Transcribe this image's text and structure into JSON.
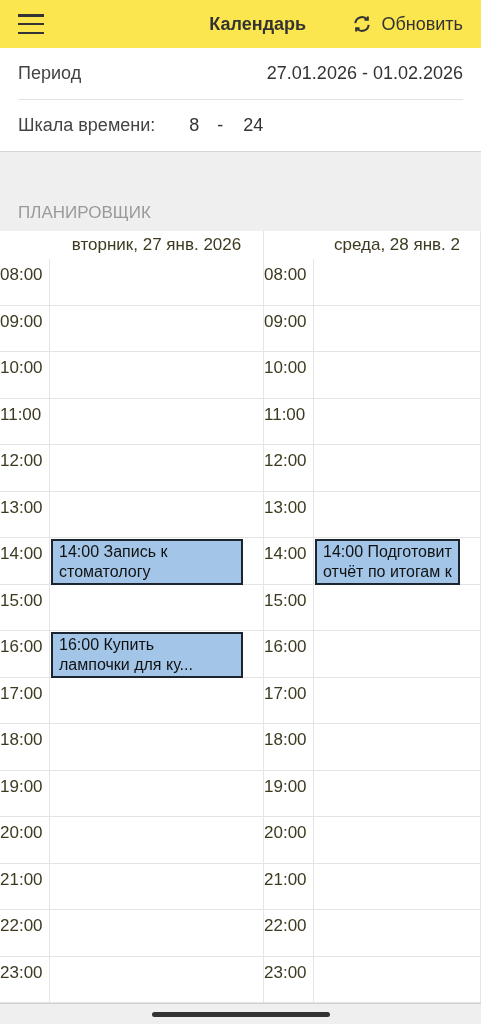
{
  "header": {
    "title": "Календарь",
    "refresh_label": "Обновить"
  },
  "period": {
    "label": "Период",
    "value": "27.01.2026 - 01.02.2026"
  },
  "time_scale": {
    "label": "Шкала времени:",
    "from": "8",
    "separator": "-",
    "to": "24"
  },
  "planner": {
    "title": "ПЛАНИРОВЩИК",
    "days": [
      {
        "label": "вторник, 27 янв. 2026",
        "slots": [
          {
            "time": "08:00"
          },
          {
            "time": "09:00"
          },
          {
            "time": "10:00"
          },
          {
            "time": "11:00"
          },
          {
            "time": "12:00"
          },
          {
            "time": "13:00"
          },
          {
            "time": "14:00",
            "event": {
              "lines": [
                "14:00 Запись к",
                "стоматологу"
              ]
            }
          },
          {
            "time": "15:00"
          },
          {
            "time": "16:00",
            "event": {
              "lines": [
                "16:00 Купить",
                "лампочки для ку..."
              ]
            }
          },
          {
            "time": "17:00"
          },
          {
            "time": "18:00"
          },
          {
            "time": "19:00"
          },
          {
            "time": "20:00"
          },
          {
            "time": "21:00"
          },
          {
            "time": "22:00"
          },
          {
            "time": "23:00"
          }
        ]
      },
      {
        "label": "среда, 28 янв. 2",
        "slots": [
          {
            "time": "08:00"
          },
          {
            "time": "09:00"
          },
          {
            "time": "10:00"
          },
          {
            "time": "11:00"
          },
          {
            "time": "12:00"
          },
          {
            "time": "13:00"
          },
          {
            "time": "14:00",
            "event": {
              "lines": [
                "14:00 Подготовит",
                "отчёт по итогам к"
              ]
            }
          },
          {
            "time": "15:00"
          },
          {
            "time": "16:00"
          },
          {
            "time": "17:00"
          },
          {
            "time": "18:00"
          },
          {
            "time": "19:00"
          },
          {
            "time": "20:00"
          },
          {
            "time": "21:00"
          },
          {
            "time": "22:00"
          },
          {
            "time": "23:00"
          }
        ]
      }
    ]
  }
}
